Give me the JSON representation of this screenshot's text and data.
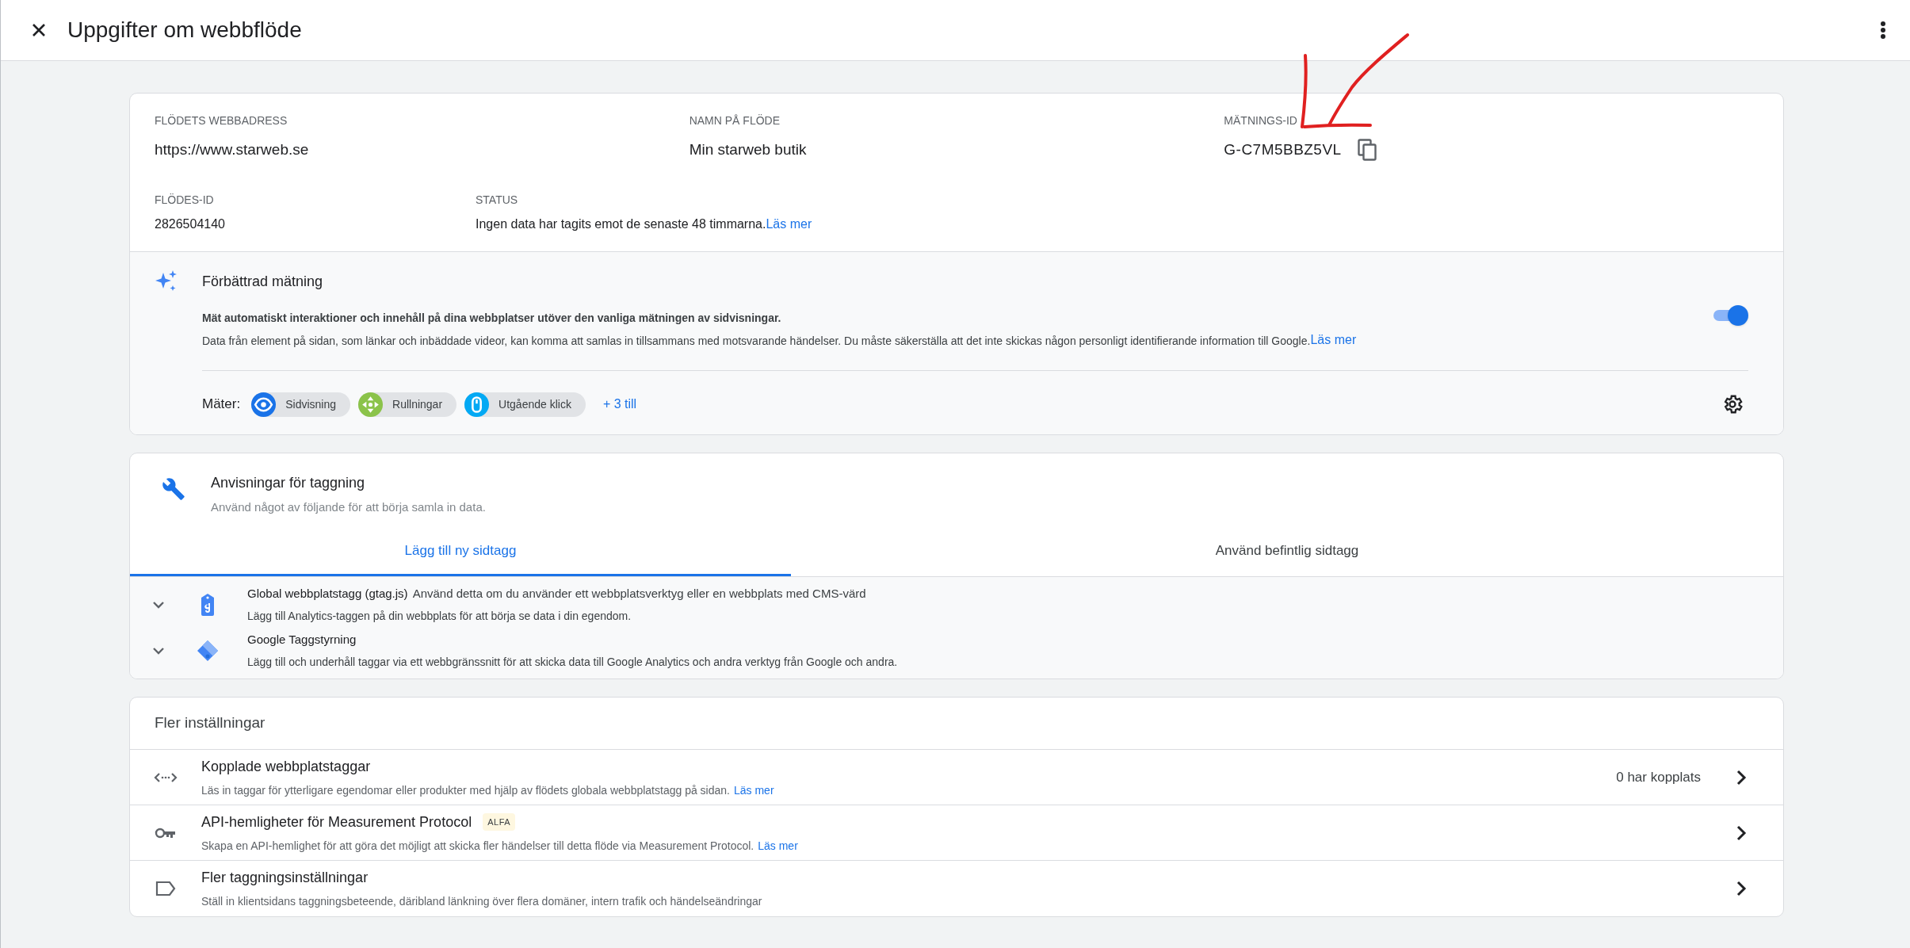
{
  "header": {
    "title": "Uppgifter om webbflöde"
  },
  "stream_details": {
    "fields": [
      {
        "label": "FLÖDETS WEBBADRESS",
        "value": "https://www.starweb.se"
      },
      {
        "label": "NAMN PÅ FLÖDE",
        "value": "Min starweb butik"
      },
      {
        "label": "MÄTNINGS-ID",
        "value": "G-C7M5BBZ5VL"
      }
    ],
    "stream_id": {
      "label": "FLÖDES-ID",
      "value": "2826504140"
    },
    "status": {
      "label": "STATUS",
      "value": "Ingen data har tagits emot de senaste 48 timmarna.",
      "link": "Läs mer"
    }
  },
  "enhanced_measurement": {
    "title": "Förbättrad mätning",
    "on": true,
    "description_bold": "Mät automatiskt interaktioner och innehåll på dina webbplatser utöver den vanliga mätningen av sidvisningar.",
    "description": "Data från element på sidan, som länkar och inbäddade videor, kan komma att samlas in tillsammans med motsvarande händelser. Du måste säkerställa att det inte skickas någon personligt identifierande information till Google.",
    "link": "Läs mer",
    "measures_label": "Mäter:",
    "chips": [
      {
        "label": "Sidvisning",
        "kind": "eye",
        "color": "#1a73e8"
      },
      {
        "label": "Rullningar",
        "kind": "scroll",
        "color": "#8bc34a"
      },
      {
        "label": "Utgående klick",
        "kind": "mouse",
        "color": "#03a9f4"
      }
    ],
    "more": "+ 3 till"
  },
  "tagging": {
    "title": "Anvisningar för taggning",
    "subtitle": "Använd något av följande för att börja samla in data.",
    "tabs": [
      {
        "label": "Lägg till ny sidtagg",
        "selected": true
      },
      {
        "label": "Använd befintlig sidtagg",
        "selected": false
      }
    ],
    "options": [
      {
        "kind": "gtag",
        "title": "Global webbplatstagg (gtag.js)",
        "title_note": "Använd detta om du använder ett webbplatsverktyg eller en webbplats med CMS-värd",
        "description": "Lägg till Analytics-taggen på din webbplats för att börja se data i din egendom.",
        "expanded": false
      },
      {
        "kind": "gtm",
        "title": "Google Taggstyrning",
        "description": "Lägg till och underhåll taggar via ett webbgränssnitt för att skicka data till Google Analytics och andra verktyg från Google och andra.",
        "expanded": false
      }
    ]
  },
  "more_settings": {
    "title": "Fler inställningar",
    "rows": [
      {
        "kind": "code",
        "title": "Kopplade webbplatstaggar",
        "description": "Läs in taggar för ytterligare egendomar eller produkter med hjälp av flödets globala webbplatstagg på sidan.",
        "link": "Läs mer",
        "value": "0 har kopplats"
      },
      {
        "kind": "key",
        "title": "API-hemligheter för Measurement Protocol",
        "badge": "ALFA",
        "description": "Skapa en API-hemlighet för att göra det möjligt att skicka fler händelser till detta flöde via Measurement Protocol.",
        "link": "Läs mer"
      },
      {
        "kind": "label",
        "title": "Fler taggningsinställningar",
        "description": "Ställ in klientsidans taggningsbeteende, däribland länkning över flera domäner, intern trafik och händelseändringar"
      }
    ]
  }
}
